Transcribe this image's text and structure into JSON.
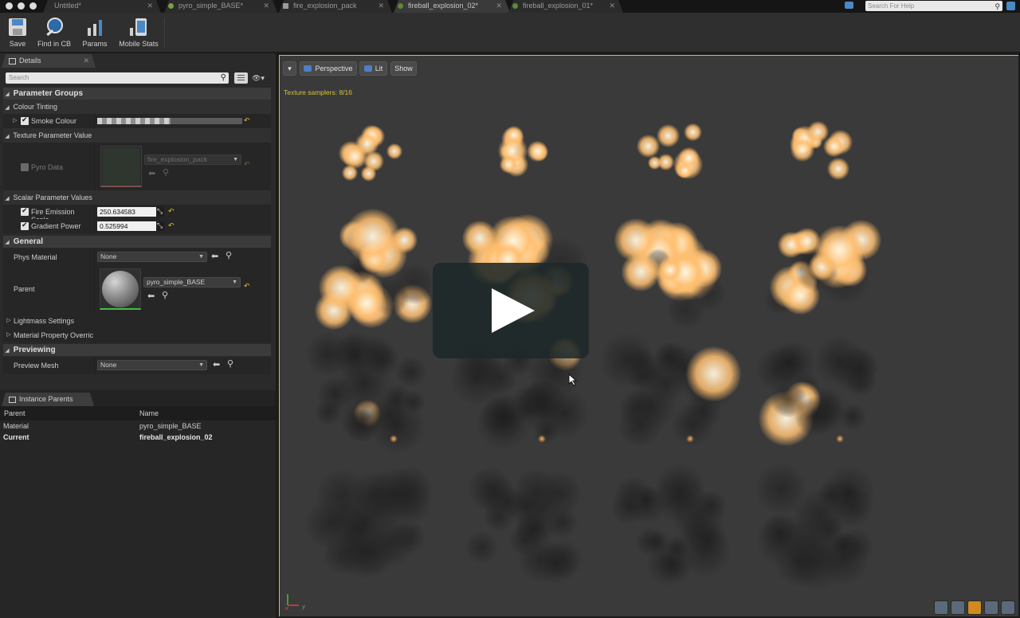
{
  "tabs": [
    {
      "label": "Untitled*",
      "active": false
    },
    {
      "label": "pyro_simple_BASE*",
      "active": false
    },
    {
      "label": "fire_explosion_pack",
      "active": false
    },
    {
      "label": "fireball_explosion_02*",
      "active": true
    },
    {
      "label": "fireball_explosion_01*",
      "active": false
    }
  ],
  "help_search": {
    "placeholder": "Search For Help"
  },
  "toolbar": {
    "save_label": "Save",
    "find_label": "Find in CB",
    "params_label": "Params",
    "mobile_stats_label": "Mobile Stats"
  },
  "details": {
    "tab_label": "Details",
    "search_placeholder": "Search",
    "parameter_groups_label": "Parameter Groups",
    "colour_tinting_label": "Colour Tinting",
    "smoke_colour_label": "Smoke Colour",
    "texture_param_label": "Texture Parameter Value",
    "pyro_data_label": "Pyro Data",
    "pyro_texture_value": "fire_explosion_pack",
    "scalar_param_label": "Scalar Parameter Values",
    "fire_emission_label": "Fire Emission Scale",
    "fire_emission_value": "250.634583",
    "gradient_power_label": "Gradient Power",
    "gradient_power_value": "0.525994",
    "general_label": "General",
    "phys_material_label": "Phys Material",
    "phys_material_value": "None",
    "parent_label": "Parent",
    "parent_value": "pyro_simple_BASE",
    "lightmass_label": "Lightmass Settings",
    "mat_override_label": "Material Property Overric",
    "previewing_label": "Previewing",
    "preview_mesh_label": "Preview Mesh",
    "preview_mesh_value": "None"
  },
  "instance_parents": {
    "tab_label": "Instance Parents",
    "col_parent": "Parent",
    "col_name": "Name",
    "rows": [
      {
        "parent": "Material",
        "name": "pyro_simple_BASE",
        "bold": false
      },
      {
        "parent": "Current",
        "name": "fireball_explosion_02",
        "bold": true
      }
    ]
  },
  "viewport": {
    "perspective_label": "Perspective",
    "lit_label": "Lit",
    "show_label": "Show",
    "texture_samplers": "Texture samplers: 8/16",
    "accent_color": "#ffb020"
  },
  "icons": [
    "close-icon",
    "search-icon",
    "save-icon",
    "find-icon",
    "params-icon",
    "mobile-stats-icon",
    "play-icon",
    "eye-icon",
    "grid-icon",
    "arrow-left-icon",
    "magnifier-icon",
    "reset-arrow-icon"
  ]
}
